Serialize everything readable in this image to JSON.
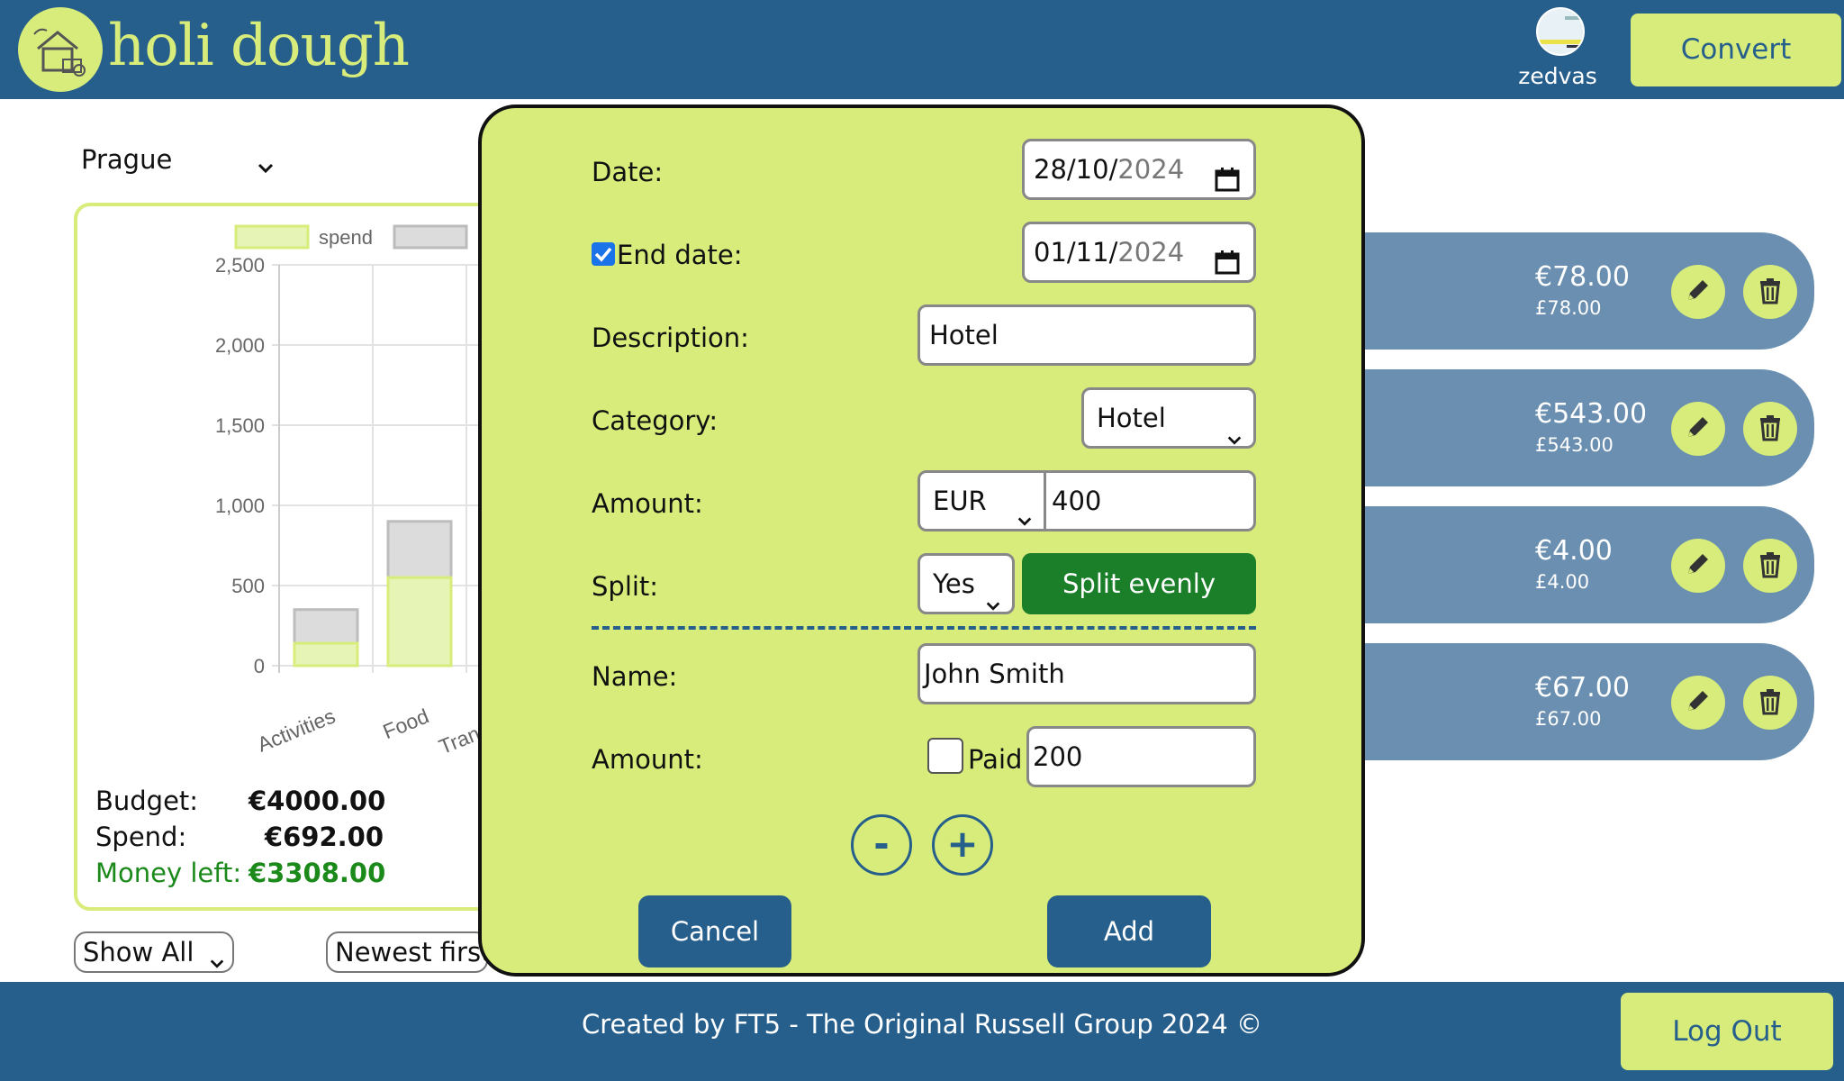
{
  "header": {
    "app_name": "holi dough",
    "username": "zedvas",
    "convert_label": "Convert"
  },
  "trip": {
    "selected_city": "Prague"
  },
  "stats": {
    "budget_label": "Budget:",
    "budget_value": "€4000.00",
    "spend_label": "Spend:",
    "spend_value": "€692.00",
    "left_label": "Money left:",
    "left_value": "€3308.00"
  },
  "chart_data": {
    "type": "bar",
    "categories": [
      "Activities",
      "Food",
      "Transport"
    ],
    "series": [
      {
        "name": "spend",
        "values": [
          140,
          550,
          null
        ]
      },
      {
        "name": "",
        "values": [
          350,
          900,
          null
        ]
      }
    ],
    "yticks": [
      "0",
      "500",
      "1,000",
      "1,500",
      "2,000",
      "2,500"
    ],
    "ylim": [
      0,
      2500
    ],
    "legend_position": "top",
    "colors": {
      "spend": "#e6f5b6",
      "budget": "#dcdcdc"
    }
  },
  "filters": {
    "show_value": "Show All",
    "sort_value": "Newest first"
  },
  "expenses": [
    {
      "amount": "€78.00",
      "converted": "£78.00"
    },
    {
      "amount": "€543.00",
      "converted": "£543.00"
    },
    {
      "amount": "€4.00",
      "converted": "£4.00"
    },
    {
      "amount": "€67.00",
      "converted": "£67.00"
    }
  ],
  "modal": {
    "date_label": "Date:",
    "date_value_day": "28/10/",
    "date_value_year": "2024",
    "end_date_label": "End date:",
    "end_date_value_day": "01/11/",
    "end_date_value_year": "2024",
    "description_label": "Description:",
    "description_value": "Hotel",
    "category_label": "Category:",
    "category_value": "Hotel",
    "amount_label": "Amount:",
    "currency_value": "EUR",
    "amount_value": "400",
    "split_label": "Split:",
    "split_value": "Yes",
    "split_evenly_label": "Split evenly",
    "name_label": "Name:",
    "name_value": "John Smith",
    "person_amount_label": "Amount:",
    "paid_label": "Paid",
    "person_amount_value": "200",
    "minus_label": "-",
    "plus_label": "+",
    "cancel_label": "Cancel",
    "add_label": "Add"
  },
  "footer": {
    "credit": "Created by FT5 - The Original Russell Group 2024 ©",
    "logout_label": "Log Out"
  },
  "colors": {
    "primary": "#265e8c",
    "accent": "#d7ec7a",
    "success": "#1b7f2a"
  }
}
